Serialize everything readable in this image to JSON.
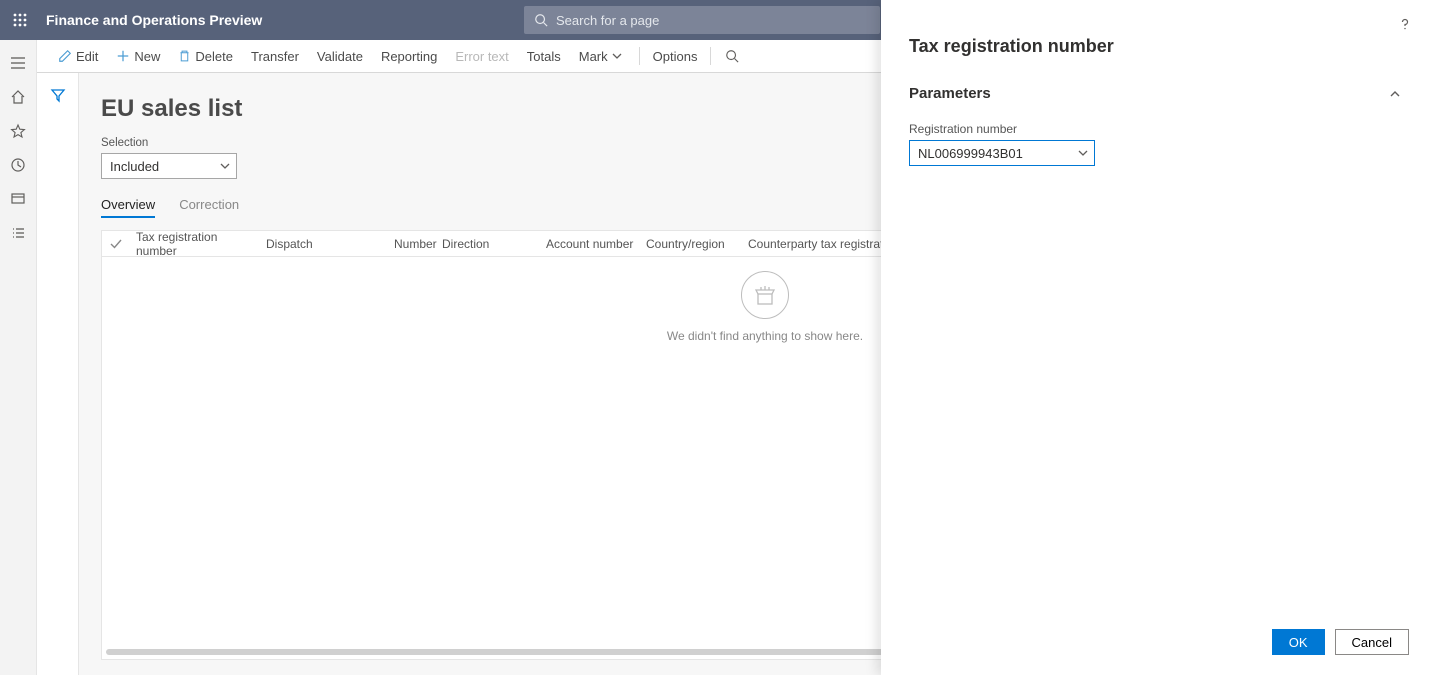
{
  "app": {
    "title": "Finance and Operations Preview",
    "search_placeholder": "Search for a page"
  },
  "commands": {
    "edit": "Edit",
    "new": "New",
    "delete": "Delete",
    "transfer": "Transfer",
    "validate": "Validate",
    "reporting": "Reporting",
    "error_text": "Error text",
    "totals": "Totals",
    "mark": "Mark",
    "options": "Options"
  },
  "page": {
    "title": "EU sales list",
    "selection_label": "Selection",
    "selection_value": "Included",
    "tabs": {
      "overview": "Overview",
      "correction": "Correction"
    },
    "empty_message": "We didn't find anything to show here."
  },
  "columns": {
    "tax_reg": "Tax registration number",
    "dispatch": "Dispatch",
    "number": "Number",
    "direction": "Direction",
    "account": "Account number",
    "country": "Country/region",
    "counterparty": "Counterparty tax registration"
  },
  "panel": {
    "title": "Tax registration number",
    "section": "Parameters",
    "field_label": "Registration number",
    "field_value": "NL006999943B01",
    "ok": "OK",
    "cancel": "Cancel"
  }
}
